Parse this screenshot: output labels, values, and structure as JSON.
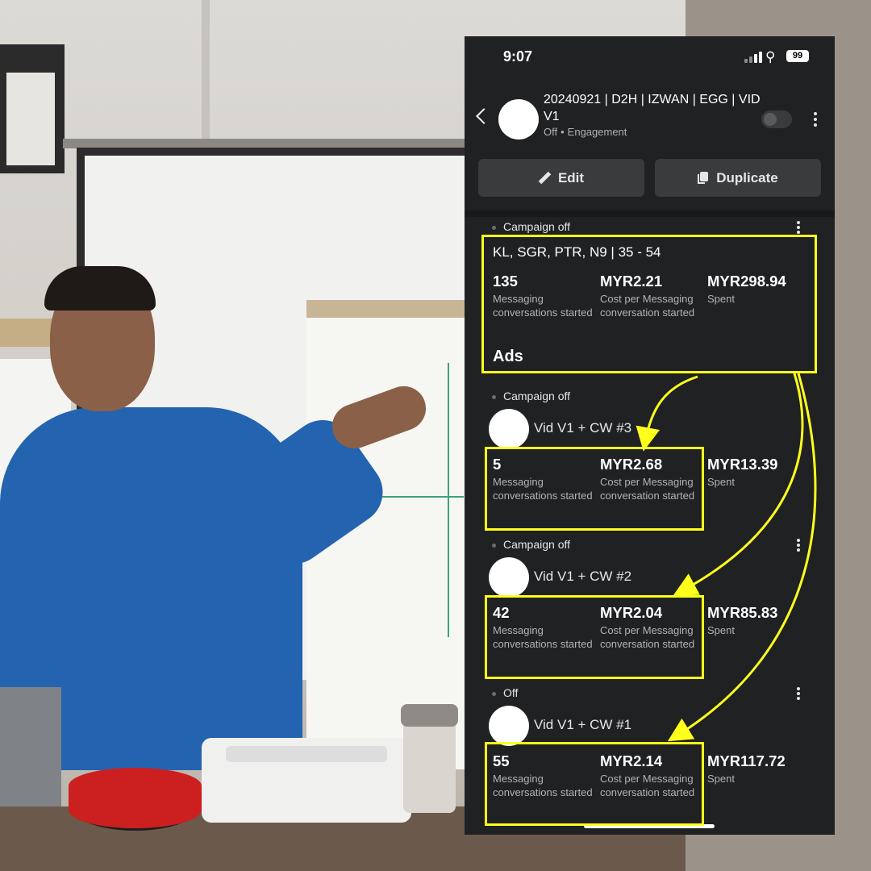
{
  "status_bar": {
    "time": "9:07",
    "battery": "99"
  },
  "campaign": {
    "title": "20240921 | D2H | IZWAN | EGG | VID V1",
    "status": "Off",
    "separator": "•",
    "objective": "Engagement"
  },
  "actions": {
    "edit_label": "Edit",
    "duplicate_label": "Duplicate"
  },
  "ad_set": {
    "status": "Campaign off",
    "name": "KL, SGR, PTR, N9 | 35 - 54",
    "metrics": [
      {
        "value": "135",
        "label": "Messaging conversations started"
      },
      {
        "value": "MYR2.21",
        "label": "Cost per Messaging conversation started"
      },
      {
        "value": "MYR298.94",
        "label": "Spent"
      }
    ]
  },
  "ads_heading": "Ads",
  "ads": [
    {
      "status": "Campaign off",
      "name": "Vid V1 + CW #3",
      "metrics": [
        {
          "value": "5",
          "label": "Messaging conversations started"
        },
        {
          "value": "MYR2.68",
          "label": "Cost per Messaging conversation started"
        },
        {
          "value": "MYR13.39",
          "label": "Spent"
        }
      ]
    },
    {
      "status": "Campaign off",
      "name": "Vid V1 + CW #2",
      "metrics": [
        {
          "value": "42",
          "label": "Messaging conversations started"
        },
        {
          "value": "MYR2.04",
          "label": "Cost per Messaging conversation started"
        },
        {
          "value": "MYR85.83",
          "label": "Spent"
        }
      ]
    },
    {
      "status": "Off",
      "name": "Vid V1 + CW #1",
      "metrics": [
        {
          "value": "55",
          "label": "Messaging conversations started"
        },
        {
          "value": "MYR2.14",
          "label": "Cost per Messaging conversation started"
        },
        {
          "value": "MYR117.72",
          "label": "Spent"
        }
      ]
    }
  ],
  "colors": {
    "screen_bg": "#202122",
    "highlight": "#ffff1c",
    "button_bg": "#3a3b3c",
    "secondary_text": "#b0b3b8"
  },
  "icons": [
    "back-chevron-icon",
    "more-options-icon",
    "pencil-icon",
    "copy-icon",
    "wifi-icon",
    "signal-icon",
    "battery-icon"
  ]
}
